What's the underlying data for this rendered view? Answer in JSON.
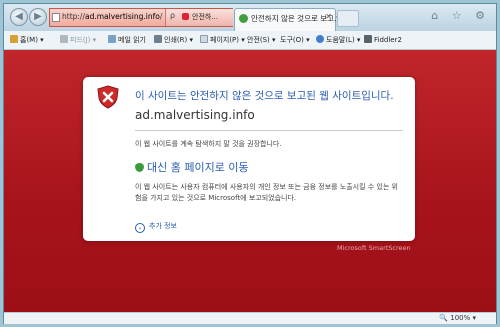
{
  "browser": {
    "address_url_prefix": "http://",
    "address_url_domain": "ad.malvertising.info",
    "address_url_suffix": "/",
    "security_status": "안전하...",
    "tab_title": "안전하지 않은 것으로 보고...",
    "window_controls": "⌂ ☆ ⚙"
  },
  "commandbar": {
    "items": [
      {
        "label": "홈(M)",
        "icon": "home-icon"
      },
      {
        "label": "피드(J)",
        "icon": "feed-icon"
      },
      {
        "label": "메일 읽기",
        "icon": "mail-icon"
      },
      {
        "label": "인쇄(R)",
        "icon": "print-icon"
      },
      {
        "label": "페이지(P)",
        "icon": "page-icon"
      },
      {
        "label": "안전(S)",
        "icon": "safety-icon"
      },
      {
        "label": "도구(O)",
        "icon": "tools-icon"
      },
      {
        "label": "도움말(L)",
        "icon": "help-icon"
      },
      {
        "label": "Fiddler2",
        "icon": "fiddler-icon"
      }
    ]
  },
  "warning": {
    "headline": "이 사이트는 안전하지 않은 것으로 보고된 웹 사이트입니다.",
    "domain": "ad.malvertising.info",
    "recommendation": "이 웹 사이트를 계속 탐색하지 말 것을 권장합니다.",
    "home_link": "대신 홈 페이지로 이동",
    "description": "이 웹 사이트는 사용자 컴퓨터에 사용자의 개인 정보 또는 금융 정보를 노출시킬 수 있는 위험을 가지고 있는 것으로 Microsoft에 보고되었습니다.",
    "more_info": "추가 정보",
    "brand": "Microsoft SmartScreen"
  },
  "statusbar": {
    "zoom": "100%"
  },
  "colors": {
    "danger_bg": "#b51c22",
    "link_blue": "#2a5db0"
  }
}
